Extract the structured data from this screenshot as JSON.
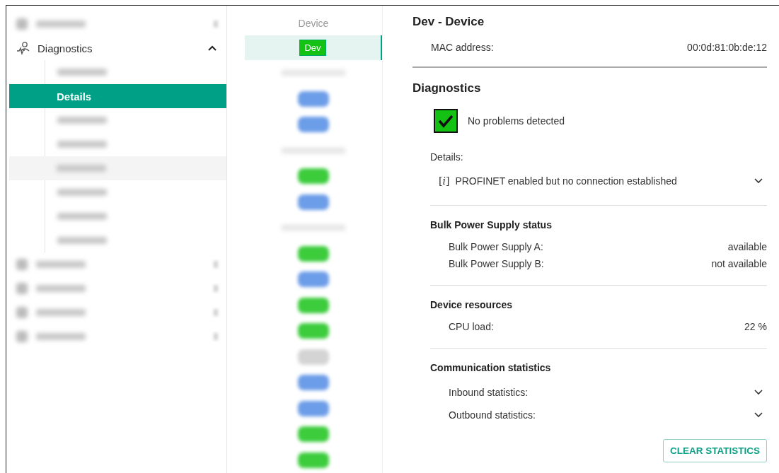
{
  "sidebar": {
    "items": [
      {
        "kind": "blurred",
        "selected": false
      },
      {
        "kind": "group",
        "label": "Diagnostics",
        "selected": false,
        "expanded": true,
        "children": [
          {
            "kind": "blurred",
            "selected": false,
            "hovered": false
          },
          {
            "kind": "entry",
            "label": "Details",
            "selected": true,
            "hovered": false
          },
          {
            "kind": "blurred",
            "selected": false,
            "hovered": false
          },
          {
            "kind": "blurred",
            "selected": false,
            "hovered": false
          },
          {
            "kind": "blurred",
            "selected": false,
            "hovered": true
          },
          {
            "kind": "blurred",
            "selected": false,
            "hovered": false
          },
          {
            "kind": "blurred",
            "selected": false,
            "hovered": false
          },
          {
            "kind": "blurred",
            "selected": false,
            "hovered": false
          }
        ]
      },
      {
        "kind": "blurred",
        "selected": false
      },
      {
        "kind": "blurred",
        "selected": false
      },
      {
        "kind": "blurred",
        "selected": false
      },
      {
        "kind": "blurred",
        "selected": false
      }
    ]
  },
  "device_list": {
    "header": "Device",
    "items": [
      {
        "kind": "device",
        "label": "Dev",
        "selected": true,
        "color": "#14c214"
      },
      {
        "kind": "caption",
        "selected": false
      },
      {
        "kind": "badge",
        "selected": false,
        "color": "#6c9de8"
      },
      {
        "kind": "badge",
        "selected": false,
        "color": "#6c9de8"
      },
      {
        "kind": "caption",
        "selected": false
      },
      {
        "kind": "badge",
        "selected": false,
        "color": "#3ccc3c"
      },
      {
        "kind": "badge",
        "selected": false,
        "color": "#6c9de8"
      },
      {
        "kind": "caption",
        "selected": false
      },
      {
        "kind": "badge",
        "selected": false,
        "color": "#3ccc3c"
      },
      {
        "kind": "badge",
        "selected": false,
        "color": "#6c9de8"
      },
      {
        "kind": "badge",
        "selected": false,
        "color": "#3ccc3c"
      },
      {
        "kind": "badge",
        "selected": false,
        "color": "#3ccc3c"
      },
      {
        "kind": "badge",
        "selected": false,
        "color": "#d4d4d4"
      },
      {
        "kind": "badge",
        "selected": false,
        "color": "#6c9de8"
      },
      {
        "kind": "badge",
        "selected": false,
        "color": "#6c9de8"
      },
      {
        "kind": "badge",
        "selected": false,
        "color": "#3ccc3c"
      },
      {
        "kind": "badge",
        "selected": false,
        "color": "#3ccc3c"
      }
    ]
  },
  "device": {
    "title": "Dev - Device",
    "mac_label": "MAC address:",
    "mac_value": "00:0d:81:0b:de:12"
  },
  "diagnostics": {
    "title": "Diagnostics",
    "problems_detected": false,
    "status_text": "No problems detected",
    "details_label": "Details:",
    "messages": [
      {
        "icon": "[*i*]",
        "text": "PROFINET enabled but no connection established",
        "expanded": false
      }
    ]
  },
  "sections": [
    {
      "title": "Bulk Power Supply status",
      "rows": [
        {
          "kind": "value",
          "label": "Bulk Power Supply A:",
          "value": "available"
        },
        {
          "kind": "value",
          "label": "Bulk Power Supply B:",
          "value": "not available"
        }
      ]
    },
    {
      "title": "Device resources",
      "rows": [
        {
          "kind": "value",
          "label": "CPU load:",
          "value": "22 %"
        }
      ]
    },
    {
      "title": "Communication statistics",
      "rows": [
        {
          "kind": "expander",
          "label": "Inbound statistics:",
          "expanded": false
        },
        {
          "kind": "expander",
          "label": "Outbound statistics:",
          "expanded": false
        }
      ]
    }
  ],
  "clear_button": "CLEAR STATISTICS"
}
